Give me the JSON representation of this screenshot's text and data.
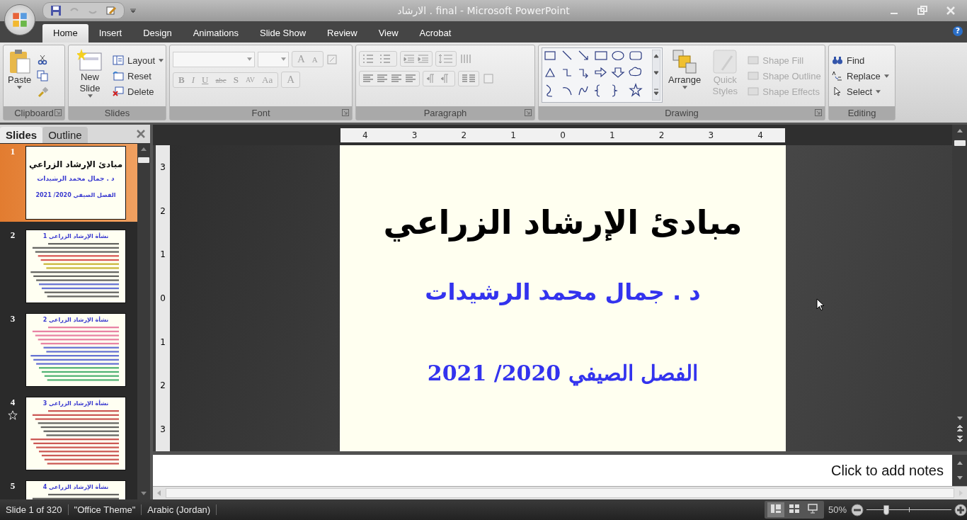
{
  "window": {
    "title": "الارشاد . final - Microsoft PowerPoint",
    "help": "?"
  },
  "tabs": [
    {
      "label": "Home",
      "selected": true
    },
    {
      "label": "Insert",
      "selected": false
    },
    {
      "label": "Design",
      "selected": false
    },
    {
      "label": "Animations",
      "selected": false
    },
    {
      "label": "Slide Show",
      "selected": false
    },
    {
      "label": "Review",
      "selected": false
    },
    {
      "label": "View",
      "selected": false
    },
    {
      "label": "Acrobat",
      "selected": false
    }
  ],
  "ribbon": {
    "clipboard": {
      "label": "Clipboard",
      "paste": "Paste"
    },
    "slides": {
      "label": "Slides",
      "new_slide": "New Slide",
      "items": [
        {
          "label": "Layout",
          "kind": "layout"
        },
        {
          "label": "Reset",
          "kind": "reset"
        },
        {
          "label": "Delete",
          "kind": "delete"
        }
      ]
    },
    "font": {
      "label": "Font",
      "size_buttons": [
        "A",
        "A"
      ],
      "buttons": [
        {
          "glyph": "B",
          "kind": "bold"
        },
        {
          "glyph": "I",
          "kind": "italic"
        },
        {
          "glyph": "U",
          "kind": "underline"
        },
        {
          "glyph": "abc",
          "kind": "strike"
        },
        {
          "glyph": "S",
          "kind": "shadow"
        },
        {
          "glyph": "AV",
          "kind": "spacing"
        },
        {
          "glyph": "Aa",
          "kind": "case"
        },
        {
          "glyph": "A",
          "kind": "color"
        }
      ],
      "disabled": true
    },
    "paragraph": {
      "label": "Paragraph"
    },
    "drawing": {
      "label": "Drawing",
      "arrange": "Arrange",
      "quick_styles": "Quick Styles",
      "shape_items": [
        {
          "label": "Shape Fill",
          "disabled": true
        },
        {
          "label": "Shape Outline",
          "disabled": true
        },
        {
          "label": "Shape Effects",
          "disabled": true
        }
      ]
    },
    "editing": {
      "label": "Editing",
      "items": [
        {
          "label": "Find",
          "kind": "find"
        },
        {
          "label": "Replace",
          "kind": "replace"
        },
        {
          "label": "Select",
          "kind": "select"
        }
      ]
    }
  },
  "slide_panel": {
    "tabs": [
      {
        "label": "Slides",
        "selected": true
      },
      {
        "label": "Outline",
        "selected": false
      }
    ],
    "thumbnails": [
      {
        "number": "1",
        "selected": true,
        "animated": false,
        "kind": "title",
        "texts": [
          "مبادئ الإرشاد الزراعي",
          "د . جمال  محمد الرشيدات",
          "الفصل الصيفي  2020/ 2021"
        ]
      },
      {
        "number": "2",
        "selected": false,
        "animated": false,
        "kind": "content",
        "texts": [
          "نشأة الإرشاد الزراعي 1"
        ]
      },
      {
        "number": "3",
        "selected": false,
        "animated": false,
        "kind": "content",
        "texts": [
          "نشأة الإرشاد الزراعي 2"
        ]
      },
      {
        "number": "4",
        "selected": false,
        "animated": true,
        "kind": "content",
        "texts": [
          "نشأة الإرشاد الزراعي 3"
        ]
      },
      {
        "number": "5",
        "selected": false,
        "animated": false,
        "kind": "content",
        "texts": [
          "نشأة الإرشاد الزراعي 4"
        ]
      }
    ]
  },
  "rulers": {
    "horizontal": [
      "4",
      "3",
      "2",
      "1",
      "0",
      "1",
      "2",
      "3",
      "4"
    ],
    "vertical": [
      "3",
      "2",
      "1",
      "0",
      "1",
      "2",
      "3"
    ]
  },
  "slide": {
    "title": "مبادئ الإرشاد الزراعي",
    "author": "د . جمال  محمد الرشيدات",
    "term": "الفصل الصيفي  2020/ 2021"
  },
  "notes": {
    "placeholder": "Click to add notes"
  },
  "status_bar": {
    "items": [
      "Slide 1 of 320",
      "\"Office Theme\"",
      "Arabic (Jordan)"
    ],
    "views": [
      {
        "kind": "normal",
        "selected": true
      },
      {
        "kind": "sorter",
        "selected": false
      },
      {
        "kind": "show",
        "selected": false
      }
    ],
    "zoom": "50%",
    "zoom_slider": {
      "level": 0.23
    }
  }
}
